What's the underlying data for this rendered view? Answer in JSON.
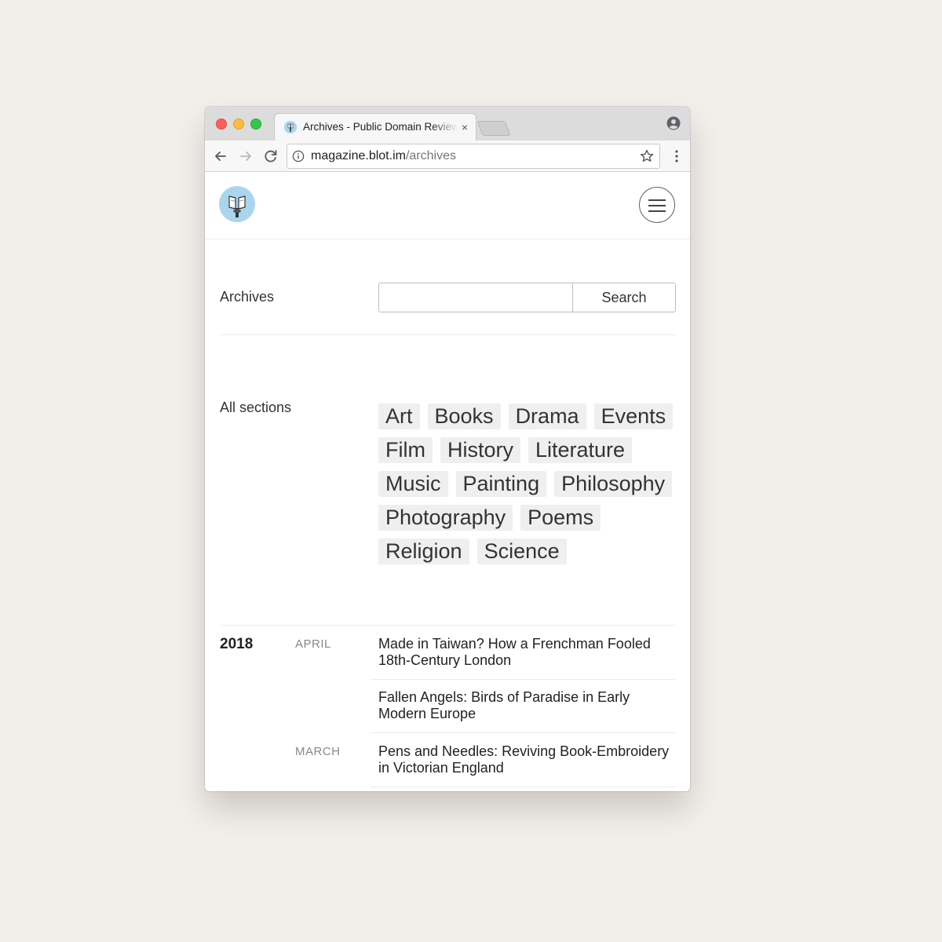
{
  "browser": {
    "tab_title": "Archives - Public Domain Review",
    "tab_close": "×",
    "url_host": "magazine.blot.im",
    "url_path": "/archives",
    "icons": {
      "back": "back-arrow-icon",
      "forward": "forward-arrow-icon",
      "reload": "reload-icon",
      "info": "info-icon",
      "bookmark": "star-icon",
      "menu": "vertical-dots-icon",
      "profile": "profile-icon"
    },
    "colors": {
      "close": "#fc605b",
      "minimize": "#fdbc40",
      "maximize": "#34c84a"
    }
  },
  "site": {
    "logo": "book-logo-icon",
    "menu_icon": "hamburger-icon",
    "accent": "#a9d6ee"
  },
  "search": {
    "label": "Archives",
    "placeholder": "",
    "value": "",
    "button_label": "Search"
  },
  "sections": {
    "label": "All sections",
    "rows": [
      [
        "Art",
        "Books",
        "Drama",
        "Events"
      ],
      [
        "Film",
        "History",
        "Literature"
      ],
      [
        "Music",
        "Painting",
        "Philosophy"
      ],
      [
        "Photography",
        "Poems"
      ],
      [
        "Religion",
        "Science"
      ]
    ]
  },
  "archive": {
    "year": "2018",
    "months": [
      "APRIL",
      "MARCH"
    ],
    "articles": [
      {
        "month": "APRIL",
        "title": "Made in Taiwan? How a Frenchman Fooled 18th-Century London"
      },
      {
        "month": "APRIL",
        "title": "Fallen Angels: Birds of Paradise in Early Modern Europe"
      },
      {
        "month": "MARCH",
        "title": "Pens and Needles: Reviving Book-Embroidery in Victorian England"
      }
    ]
  }
}
